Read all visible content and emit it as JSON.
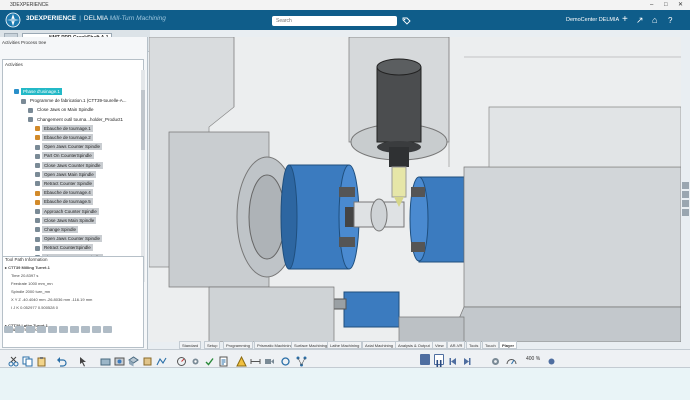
{
  "window": {
    "title": "3DEXPERIENCE",
    "controls": [
      "–",
      "□",
      "✕"
    ]
  },
  "header": {
    "brand_bold": "3DEXPERIENCE",
    "brand_company": "DELMIA",
    "brand_app": "Mill-Turn Machining",
    "search_placeholder": "Search",
    "user": "DemoCenter DELMIA",
    "icons": [
      "compass-icon",
      "tag-icon",
      "plus-icon",
      "share-icon",
      "home-icon",
      "help-icon"
    ]
  },
  "tabs": {
    "document_tab": "NMT-PPR CrankShaft A.1"
  },
  "left_panel": {
    "process_tree_label": "Activities Process tree",
    "activities_title": "Activities",
    "tree": [
      {
        "label": "Phase d'usinage.1",
        "indent": 1,
        "style": "sel",
        "icon": "#2a8fc9"
      },
      {
        "label": "Programme de fabrication.1 (CTT39-tourelle-A...",
        "indent": 2,
        "style": "",
        "icon": "#7a8a96"
      },
      {
        "label": "Close Jaws on Main Spindle",
        "indent": 3,
        "style": "",
        "icon": "#7a8a96"
      },
      {
        "label": "Changement outil tourna...holder_Product1",
        "indent": 3,
        "style": "",
        "icon": "#7a8a96"
      },
      {
        "label": "Ebauche de tournage.1",
        "indent": 4,
        "style": "hl",
        "icon": "#d28a2a"
      },
      {
        "label": "Ebauche de tournage.2",
        "indent": 4,
        "style": "hl",
        "icon": "#d28a2a"
      },
      {
        "label": "Open Jaws Counter Spindle",
        "indent": 4,
        "style": "hl",
        "icon": "#7a8a96"
      },
      {
        "label": "Part On CounterSpindle",
        "indent": 4,
        "style": "hl",
        "icon": "#7a8a96"
      },
      {
        "label": "Close Jaws Counter Spindle",
        "indent": 4,
        "style": "hl",
        "icon": "#7a8a96"
      },
      {
        "label": "Open Jaws Main Spindle",
        "indent": 4,
        "style": "hl",
        "icon": "#7a8a96"
      },
      {
        "label": "Retract Counter Spindle",
        "indent": 4,
        "style": "hl",
        "icon": "#7a8a96"
      },
      {
        "label": "Ebauche de tournage.4",
        "indent": 4,
        "style": "hl",
        "icon": "#d28a2a"
      },
      {
        "label": "Ebauche de tournage.5",
        "indent": 4,
        "style": "hl",
        "icon": "#d28a2a"
      },
      {
        "label": "Approach Counter Spindle",
        "indent": 4,
        "style": "hl",
        "icon": "#7a8a96"
      },
      {
        "label": "Close Jaws Main Spindle",
        "indent": 4,
        "style": "hl",
        "icon": "#7a8a96"
      },
      {
        "label": "Change Spindle",
        "indent": 4,
        "style": "hl",
        "icon": "#7a8a96"
      },
      {
        "label": "Open Jaws Counter Spindle",
        "indent": 4,
        "style": "hl",
        "icon": "#7a8a96"
      },
      {
        "label": "Retract CounterSpindle",
        "indent": 4,
        "style": "hl",
        "icon": "#7a8a96"
      },
      {
        "label": "Close Jaws Counter Spindle",
        "indent": 4,
        "style": "hl",
        "icon": "#7a8a96"
      }
    ],
    "tool_path_info_label": "Tool Path Information",
    "tpi_rows": [
      {
        "text": "▸ CTT39 Milling Turret.1",
        "bold": true
      },
      {
        "text": "Time            20.8397 s",
        "bold": false
      },
      {
        "text": "Feedrate        1000 mm_mn",
        "bold": false
      },
      {
        "text": "Spindle         2000 turn_mn",
        "bold": false
      },
      {
        "text": "X    Y    Z     -40.4040 mm  -26.8036 mm  -116.19 mm",
        "bold": false
      },
      {
        "text": "I    J    K     0.052977   0.500528   0",
        "bold": false
      },
      {
        "text": "▸ CTT39 Lathe Turret.1",
        "bold": true
      }
    ],
    "simulation_options_label": "Simulation Options"
  },
  "bottom_tabs": [
    "Standard",
    "Setup",
    "Programming",
    "Prismatic Machining",
    "Surface Machining",
    "Lathe Machining",
    "Axial Machining",
    "Analysis & Output",
    "View",
    "AR-VR",
    "Tools",
    "Touch",
    "Player"
  ],
  "active_bottom_tab": "Player",
  "player": {
    "zoom": "400 %"
  },
  "colors": {
    "header_bg": "#0f5d8a",
    "selection": "#23b9c7",
    "spindle_blue": "#3b7bbf"
  }
}
